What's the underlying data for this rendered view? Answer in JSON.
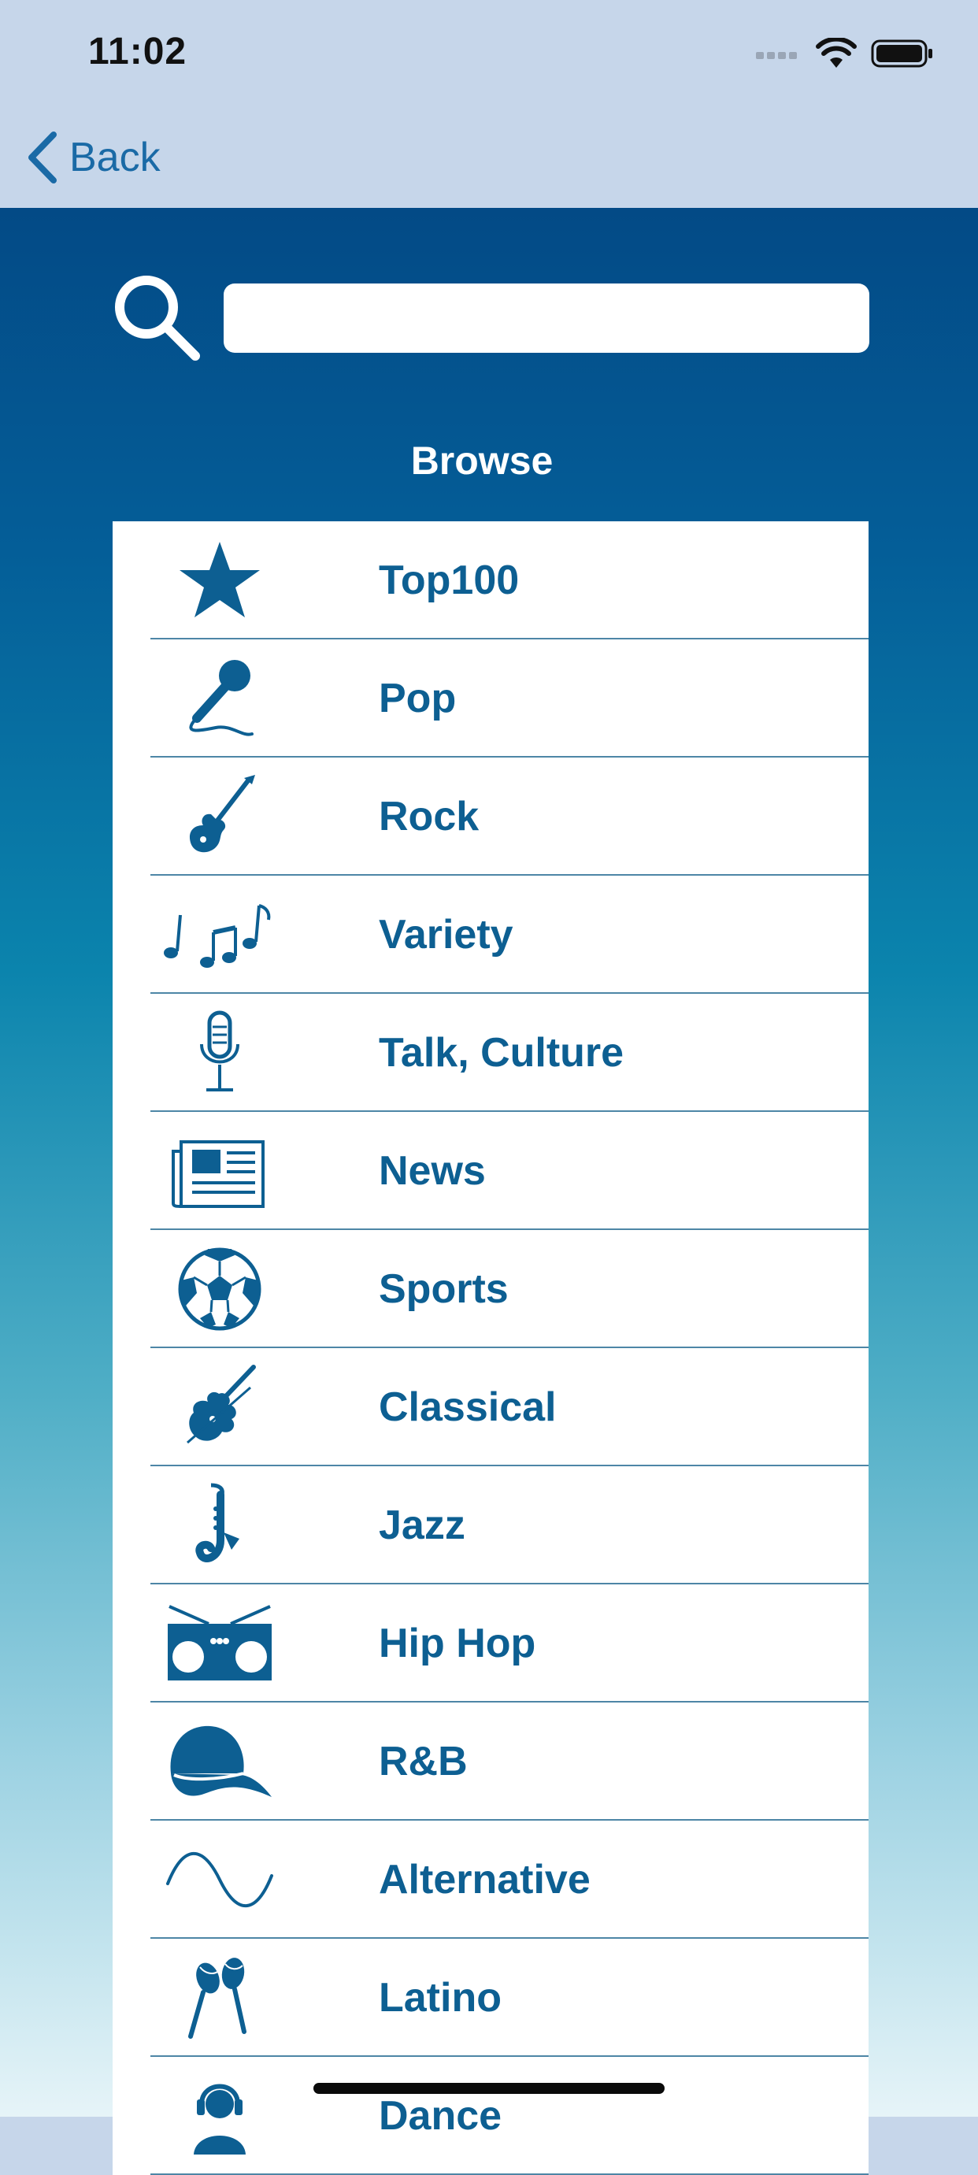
{
  "status_bar": {
    "time": "11:02"
  },
  "nav": {
    "back_label": "Back"
  },
  "search": {
    "placeholder": "",
    "value": ""
  },
  "browse": {
    "title": "Browse",
    "items": [
      {
        "label": "Top100",
        "icon": "star-icon"
      },
      {
        "label": "Pop",
        "icon": "microphone-icon"
      },
      {
        "label": "Rock",
        "icon": "electric-guitar-icon"
      },
      {
        "label": "Variety",
        "icon": "music-notes-icon"
      },
      {
        "label": "Talk, Culture",
        "icon": "podcast-mic-icon"
      },
      {
        "label": "News",
        "icon": "newspaper-icon"
      },
      {
        "label": "Sports",
        "icon": "soccer-ball-icon"
      },
      {
        "label": "Classical",
        "icon": "violin-icon"
      },
      {
        "label": "Jazz",
        "icon": "saxophone-icon"
      },
      {
        "label": "Hip Hop",
        "icon": "boombox-icon"
      },
      {
        "label": "R&B",
        "icon": "cap-icon"
      },
      {
        "label": "Alternative",
        "icon": "sine-wave-icon"
      },
      {
        "label": "Latino",
        "icon": "maracas-icon"
      },
      {
        "label": "Dance",
        "icon": "dj-headphones-icon"
      }
    ]
  },
  "colors": {
    "accent": "#0d5f92",
    "nav_background": "#c6d6ea",
    "gradient_top": "#034a86",
    "gradient_bottom": "#e6f4f8",
    "divider": "#4d86a6"
  }
}
